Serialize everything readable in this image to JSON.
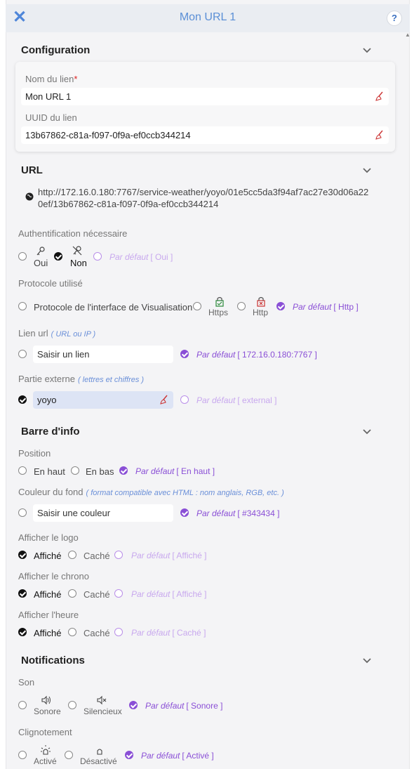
{
  "header": {
    "title": "Mon URL 1",
    "close_icon": "close-icon",
    "help_label": "?"
  },
  "configuration": {
    "title": "Configuration",
    "name_label": "Nom du lien",
    "required_mark": "*",
    "name_value": "Mon URL 1",
    "uuid_label": "UUID du lien",
    "uuid_value": "13b67862-c81a-f097-0f9a-ef0ccb344214"
  },
  "url": {
    "title": "URL",
    "link_line1": "http://172.16.0.180:7767/service-weather/yoyo/01e5cc5da3f94af7ac27e30d06a22",
    "link_line2": "0ef/13b67862-c81a-f097-0f9a-ef0ccb344214",
    "auth_label": "Authentification nécessaire",
    "auth_yes": "Oui",
    "auth_no": "Non",
    "auth_default": "Par défaut",
    "auth_default_value": "[ Oui ]",
    "protocol_label": "Protocole utilisé",
    "protocol_interface": "Protocole de l'interface de Visualisation",
    "protocol_https": "Https",
    "protocol_http": "Http",
    "protocol_default": "Par défaut",
    "protocol_default_value": "[ Http ]",
    "link_label": "Lien url",
    "link_hint": "( URL ou IP )",
    "link_placeholder": "Saisir un lien",
    "link_default": "Par défaut",
    "link_default_value": "[ 172.16.0.180:7767 ]",
    "external_label": "Partie externe",
    "external_hint": "( lettres et chiffres )",
    "external_value": "yoyo",
    "external_default": "Par défaut",
    "external_default_value": "[ external ]"
  },
  "info_bar": {
    "title": "Barre d'info",
    "position_label": "Position",
    "position_top": "En haut",
    "position_bottom": "En bas",
    "position_default": "Par défaut",
    "position_default_value": "[ En haut ]",
    "bg_label": "Couleur du fond",
    "bg_hint": "( format compatible avec HTML : nom anglais, RGB, etc. )",
    "bg_placeholder": "Saisir une couleur",
    "bg_default": "Par défaut",
    "bg_default_value": "[ #343434 ]",
    "logo_label": "Afficher le logo",
    "logo_shown": "Affiché",
    "logo_hidden": "Caché",
    "logo_default": "Par défaut",
    "logo_default_value": "[ Affiché ]",
    "chrono_label": "Afficher le chrono",
    "chrono_shown": "Affiché",
    "chrono_hidden": "Caché",
    "chrono_default": "Par défaut",
    "chrono_default_value": "[ Affiché ]",
    "time_label": "Afficher l'heure",
    "time_shown": "Affiché",
    "time_hidden": "Caché",
    "time_default": "Par défaut",
    "time_default_value": "[ Caché ]"
  },
  "notifications": {
    "title": "Notifications",
    "sound_label": "Son",
    "sound_on": "Sonore",
    "sound_off": "Silencieux",
    "sound_default": "Par défaut",
    "sound_default_value": "[ Sonore ]",
    "blink_label": "Clignotement",
    "blink_on": "Activé",
    "blink_off": "Désactivé",
    "blink_default": "Par défaut",
    "blink_default_value": "[ Activé ]"
  },
  "colors": {
    "accent": "#8a4fd6",
    "header_blue": "#5b8fd6",
    "hint_blue": "#6a8fd8"
  }
}
